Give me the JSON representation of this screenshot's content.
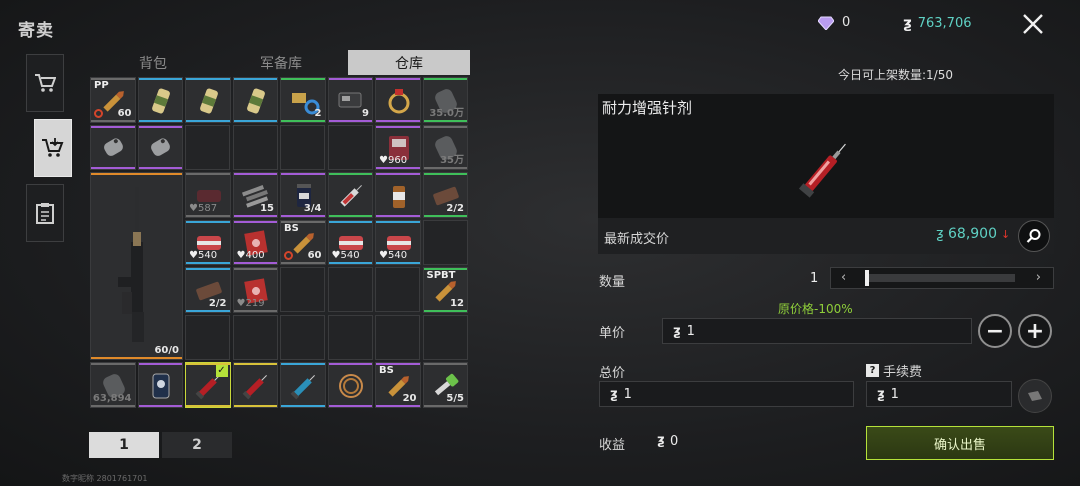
{
  "header": {
    "title": "寄卖"
  },
  "tabs": [
    {
      "label": "背包",
      "active": false
    },
    {
      "label": "军备库",
      "active": false
    },
    {
      "label": "仓库",
      "active": true
    }
  ],
  "currency": {
    "diamonds": "0",
    "coin_symbol": "ƺ",
    "coins": "763,706"
  },
  "grid_items": [
    {
      "tag": "PP",
      "count": "60",
      "rarity": "gray",
      "banned": true,
      "icon": "bullet-icon"
    },
    {
      "icon": "energy-drink-icon",
      "rarity": "blue"
    },
    {
      "icon": "energy-drink-icon",
      "rarity": "blue"
    },
    {
      "icon": "energy-drink-icon",
      "rarity": "blue"
    },
    {
      "icon": "tools-icon",
      "count": "2",
      "rarity": "green"
    },
    {
      "icon": "electronics-icon",
      "count": "9",
      "rarity": "purple"
    },
    {
      "icon": "ring-icon",
      "rarity": "purple"
    },
    {
      "icon": "canister-icon",
      "count": "35.0万",
      "dim": true,
      "rarity": "green"
    },
    {
      "icon": "dog-tag-icon",
      "rarity": "purple"
    },
    {
      "icon": "dog-tag-icon",
      "rarity": "purple"
    },
    {
      "icon": "card-icon",
      "count": "960",
      "heart": true,
      "rarity": "purple"
    },
    {
      "icon": "canister-icon",
      "count": "35万",
      "dim": true,
      "rarity": "gray"
    },
    {
      "icon": "rifle-icon",
      "count": "60/0",
      "rarity": "orange"
    },
    {
      "icon": "armband-icon",
      "count": "587",
      "heart": true,
      "dim": true,
      "rarity": "gray"
    },
    {
      "icon": "ammo-pile-icon",
      "count": "15",
      "rarity": "purple"
    },
    {
      "icon": "pill-bottle-icon",
      "count": "3/4",
      "rarity": "purple"
    },
    {
      "icon": "syringe-icon",
      "rarity": "green"
    },
    {
      "icon": "medicine-icon",
      "rarity": "purple"
    },
    {
      "icon": "bandage-icon",
      "count": "2/2",
      "rarity": "green"
    },
    {
      "icon": "medkit-icon",
      "count": "540",
      "heart": true,
      "rarity": "blue"
    },
    {
      "icon": "red-card-icon",
      "count": "400",
      "heart": true,
      "rarity": "purple"
    },
    {
      "tag": "BS",
      "count": "60",
      "banned": true,
      "icon": "bullet-icon",
      "rarity": "gray"
    },
    {
      "icon": "medkit-icon",
      "count": "540",
      "heart": true,
      "rarity": "blue"
    },
    {
      "icon": "medkit-icon",
      "count": "540",
      "heart": true,
      "rarity": "blue"
    },
    {
      "icon": "bandage-icon",
      "count": "2/2",
      "rarity": "blue"
    },
    {
      "icon": "red-card-icon",
      "count": "219",
      "heart": true,
      "dim": true,
      "rarity": "gray"
    },
    {
      "tag": "SPBT",
      "count": "12",
      "icon": "bullet-icon",
      "rarity": "green"
    },
    {
      "icon": "canister-icon",
      "count": "63,894",
      "dim": true,
      "rarity": "gray"
    },
    {
      "icon": "tablet-icon",
      "rarity": "purple"
    },
    {
      "icon": "red-syringe-icon",
      "rarity": "yellow",
      "selected": true
    },
    {
      "icon": "red-syringe-icon",
      "rarity": "yellow"
    },
    {
      "icon": "blue-syringe-icon",
      "rarity": "blue"
    },
    {
      "icon": "wire-icon",
      "rarity": "purple"
    },
    {
      "tag": "BS",
      "count": "20",
      "icon": "bullet-icon",
      "rarity": "purple"
    },
    {
      "icon": "key-icon",
      "count": "5/5",
      "rarity": "gray"
    }
  ],
  "pages": [
    "1",
    "2"
  ],
  "uid_text": "数字昵称 2801761701",
  "detail": {
    "daily_limit": "今日可上架数量:1/50",
    "item_name": "耐力增强针剂",
    "latest_price_label": "最新成交价",
    "latest_price": "68,900",
    "quantity_label": "数量",
    "quantity": "1",
    "quantity_fraction": 0.0,
    "original_price_note": "原价格-100%",
    "unit_price_label": "单价",
    "unit_price": "1",
    "total_label": "总价",
    "total": "1",
    "fee_label": "手续费",
    "fee": "1",
    "profit_label": "收益",
    "profit": "0",
    "confirm_label": "确认出售"
  },
  "colors": {
    "accent_green": "#b5e23a",
    "coin_teal": "#5fd1c4",
    "down_red": "#e0352c",
    "note_green": "#8fcf3a"
  }
}
